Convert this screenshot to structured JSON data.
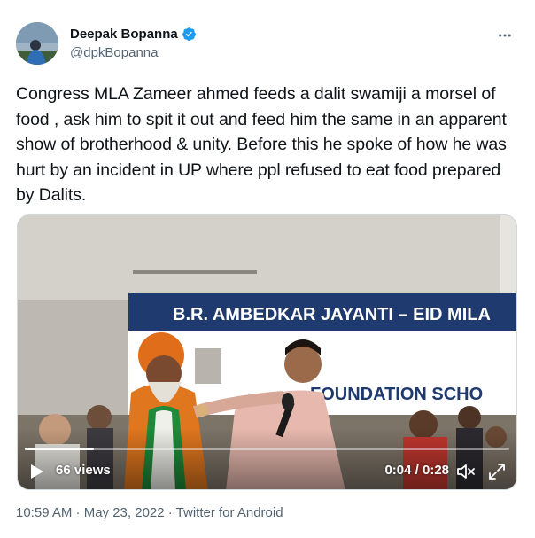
{
  "author": {
    "display_name": "Deepak Bopanna",
    "handle": "@dpkBopanna",
    "verified": true,
    "avatar_icon": "avatar-photo"
  },
  "tweet": {
    "text": "Congress MLA Zameer ahmed feeds a dalit swamiji a morsel of food , ask him to spit it out and feed him the same in an apparent show of brotherhood & unity. Before this he spoke of how he was hurt by an incident in UP where ppl refused to eat food prepared by Dalits."
  },
  "video": {
    "views": "66 views",
    "time": "0:04 / 0:28",
    "progress_fraction": 0.143,
    "banner_text_line1": "B.R. AMBEDKAR JAYANTI – EID MILA",
    "banner_text_line2": "FOUNDATION SCHO"
  },
  "meta": {
    "timestamp": "10:59 AM · May 23, 2022",
    "separator": " · ",
    "source": "Twitter for Android"
  },
  "colors": {
    "verified": "#1d9bf0",
    "secondary_text": "#536471",
    "primary_text": "#0f1419"
  }
}
